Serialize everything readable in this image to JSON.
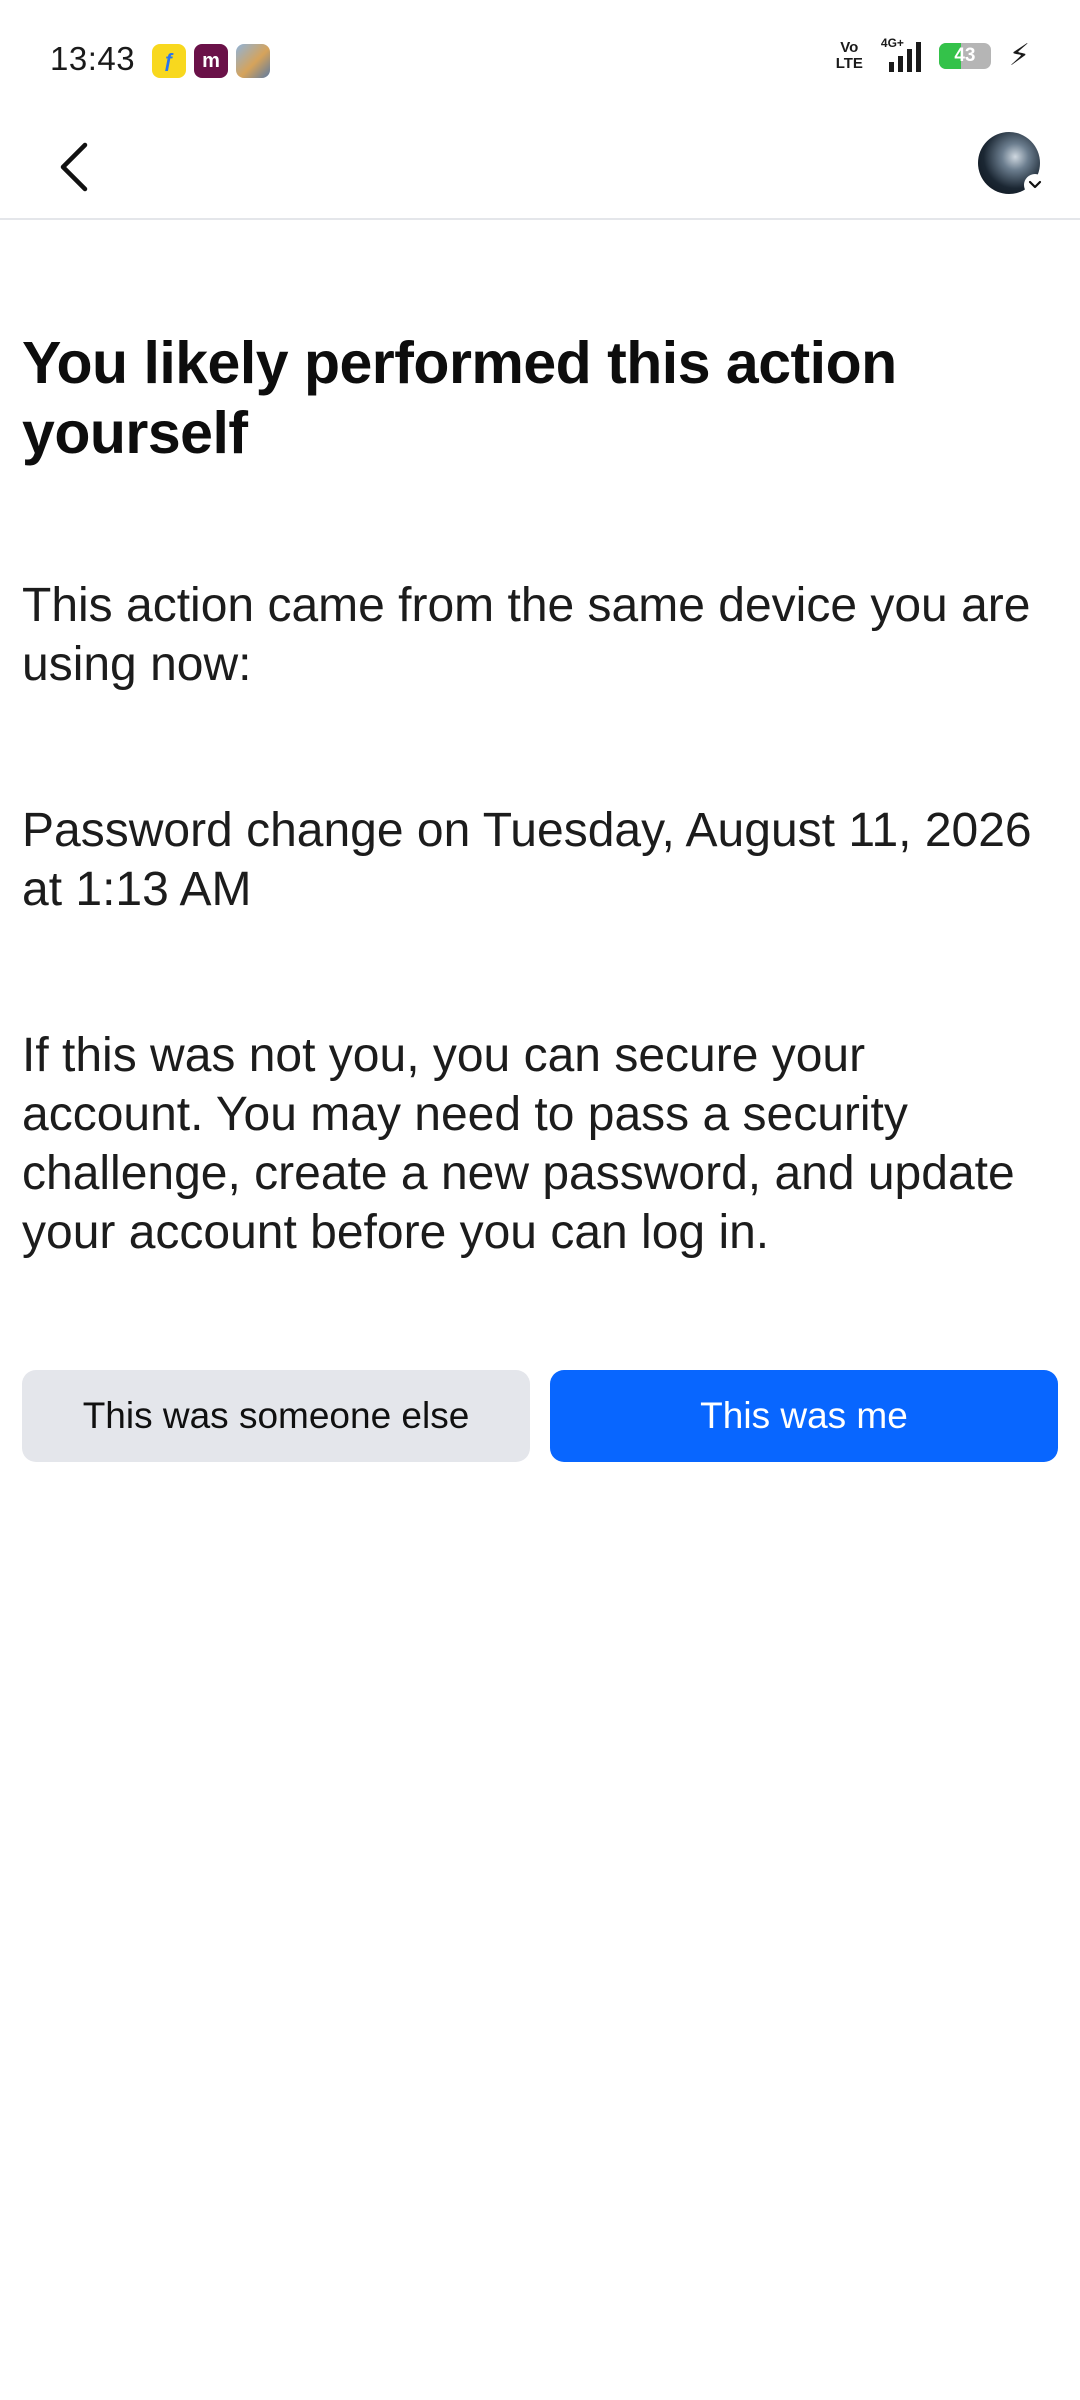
{
  "status_bar": {
    "time": "13:43",
    "notifications": [
      {
        "icon": "flipkart-app-icon",
        "glyph": "ƒ"
      },
      {
        "icon": "meesho-app-icon",
        "glyph": "m"
      },
      {
        "icon": "game-app-icon",
        "glyph": ""
      }
    ],
    "volte_line1": "Vo",
    "volte_line2": "LTE",
    "network": "4G+",
    "battery_percent": 43,
    "battery_label": "43",
    "charging": true
  },
  "nav": {
    "back_icon": "chevron-left-icon",
    "avatar_icon": "profile-avatar"
  },
  "main": {
    "title": "You likely performed this action yourself",
    "paragraph_1": "This action came from the same device you are using now:",
    "paragraph_2": "Password change on Tuesday, August 11, 2026 at 1:13 AM",
    "paragraph_3": "If this was not you, you can secure your account. You may need to pass a security challenge, create a new password, and update your account before you can log in."
  },
  "actions": {
    "secondary_label": "This was someone else",
    "primary_label": "This was me"
  },
  "colors": {
    "primary": "#0866ff",
    "secondary_bg": "#e4e6eb",
    "battery_fill": "#34c24a"
  }
}
